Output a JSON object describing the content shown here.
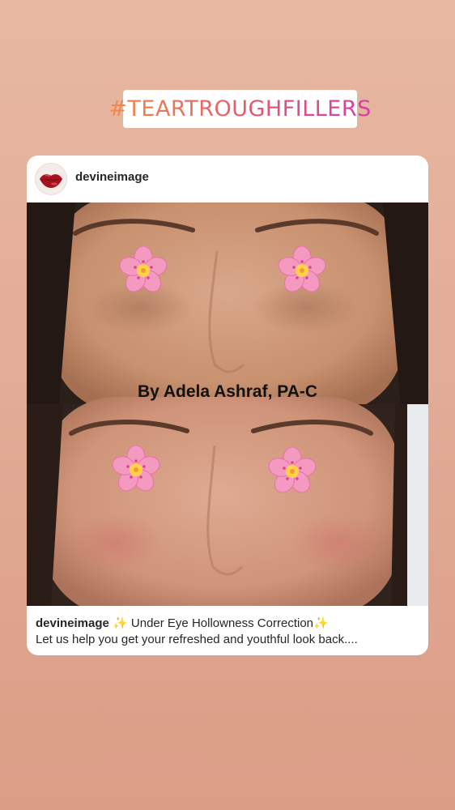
{
  "story": {
    "hashtag": "#TEARTROUGHFILLERS"
  },
  "post": {
    "username": "devineimage",
    "photo_credit": "By Adela Ashraf, PA-C",
    "caption": {
      "username": "devineimage",
      "sparkle_left": "✨",
      "title": " Under Eye Hollowness Correction",
      "sparkle_right": "✨",
      "body": "Let us help you get your refreshed and youthful look back...."
    }
  },
  "icons": {
    "avatar": "red-lips-icon",
    "sticker": "cherry-blossom-icon"
  },
  "colors": {
    "background": "#e2ac96",
    "hashtag_gradient": [
      "#f08a4b",
      "#e8566e",
      "#d43fa6"
    ],
    "card": "#ffffff",
    "blossom": "#f49ac1",
    "lips": "#a3141d"
  }
}
